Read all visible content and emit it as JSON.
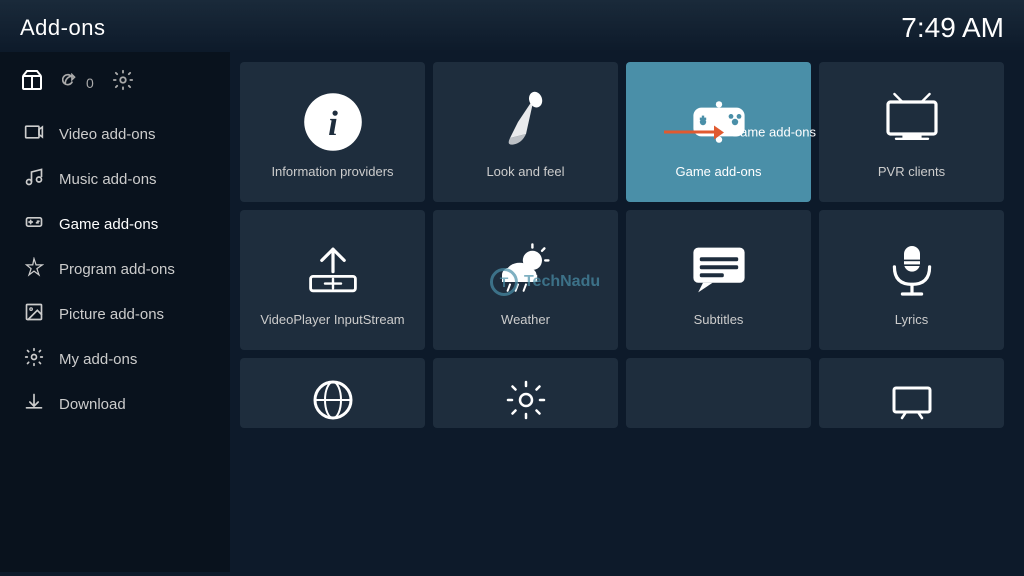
{
  "header": {
    "title": "Add-ons",
    "time": "7:49 AM"
  },
  "sidebar": {
    "icons": [
      {
        "name": "addons-icon",
        "symbol": "📦",
        "label": ""
      },
      {
        "name": "refresh-icon",
        "symbol": "↻",
        "label": "0"
      },
      {
        "name": "settings-icon",
        "symbol": "⚙",
        "label": ""
      }
    ],
    "items": [
      {
        "id": "video-addons",
        "label": "Video add-ons",
        "icon": "🎬"
      },
      {
        "id": "music-addons",
        "label": "Music add-ons",
        "icon": "🎧"
      },
      {
        "id": "game-addons",
        "label": "Game add-ons",
        "icon": "🎮"
      },
      {
        "id": "program-addons",
        "label": "Program add-ons",
        "icon": "✦"
      },
      {
        "id": "picture-addons",
        "label": "Picture add-ons",
        "icon": "🖼"
      },
      {
        "id": "my-addons",
        "label": "My add-ons",
        "icon": "⚙"
      },
      {
        "id": "download",
        "label": "Download",
        "icon": "⬇"
      }
    ]
  },
  "grid": {
    "items": [
      {
        "id": "information-providers",
        "label": "Information providers",
        "icon": "info"
      },
      {
        "id": "look-and-feel",
        "label": "Look and feel",
        "icon": "look"
      },
      {
        "id": "game-addons",
        "label": "Game add-ons",
        "icon": "gamepad",
        "active": true
      },
      {
        "id": "pvr-clients",
        "label": "PVR clients",
        "icon": "pvr"
      },
      {
        "id": "videoplayer-inputstream",
        "label": "VideoPlayer InputStream",
        "icon": "upload"
      },
      {
        "id": "weather",
        "label": "Weather",
        "icon": "weather"
      },
      {
        "id": "subtitles",
        "label": "Subtitles",
        "icon": "subtitles"
      },
      {
        "id": "lyrics",
        "label": "Lyrics",
        "icon": "lyrics"
      }
    ],
    "bottom_partial": [
      {
        "id": "item-b1",
        "icon": "globe"
      },
      {
        "id": "item-b2",
        "icon": "gear"
      },
      {
        "id": "item-b3",
        "icon": ""
      },
      {
        "id": "item-b4",
        "icon": "film"
      }
    ]
  },
  "arrow": {
    "label": "Game add-ons"
  },
  "watermark": {
    "text": "TechNadu",
    "symbol": "T"
  }
}
